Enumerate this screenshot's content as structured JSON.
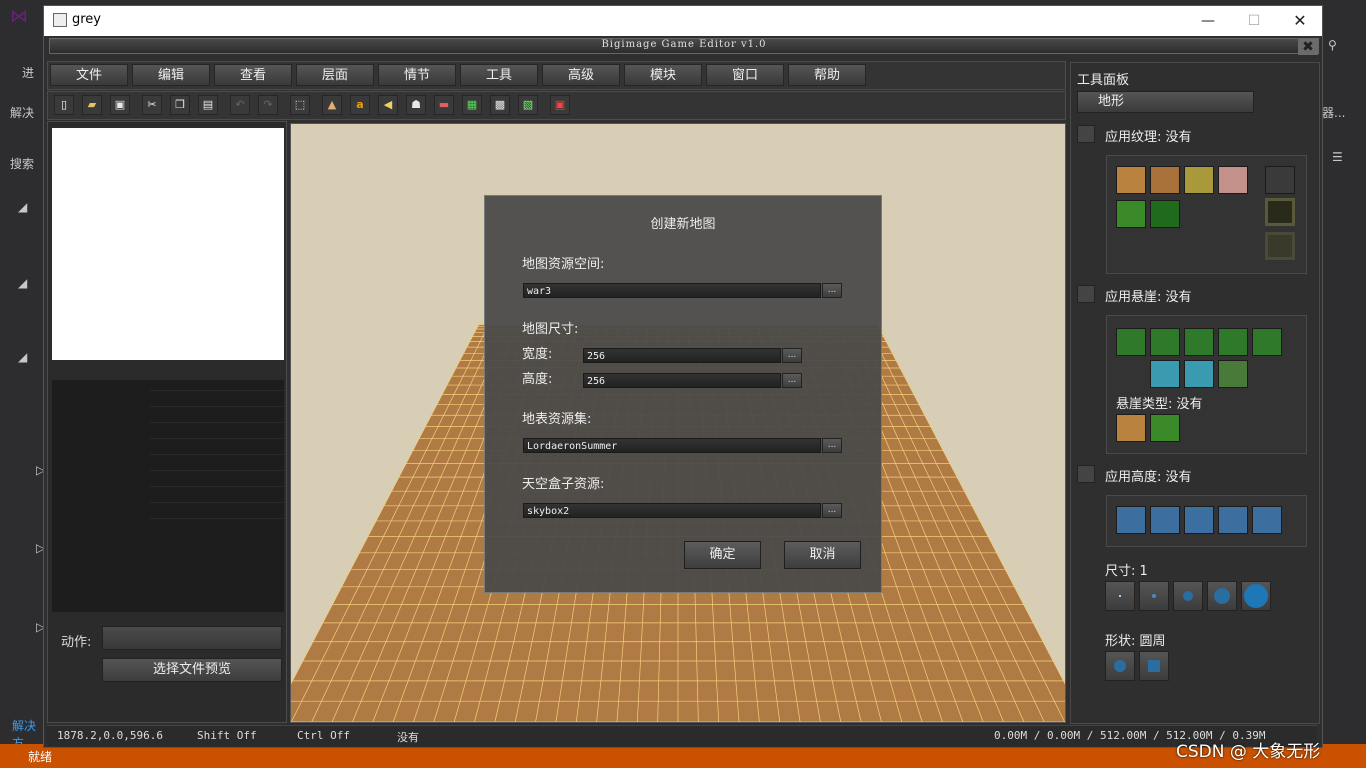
{
  "window": {
    "title": "grey",
    "editor_title": "Bigimage Game Editor v1.0"
  },
  "menu": [
    "文件",
    "编辑",
    "查看",
    "层面",
    "情节",
    "工具",
    "高级",
    "模块",
    "窗口",
    "帮助"
  ],
  "left_panel": {
    "action_label": "动作:",
    "preview_button": "选择文件预览"
  },
  "dialog": {
    "title": "创建新地图",
    "resource_space_label": "地图资源空间:",
    "resource_space_value": "war3",
    "size_label": "地图尺寸:",
    "width_label": "宽度:",
    "width_value": "256",
    "height_label": "高度:",
    "height_value": "256",
    "surface_set_label": "地表资源集:",
    "surface_set_value": "LordaeronSummer",
    "skybox_label": "天空盒子资源:",
    "skybox_value": "skybox2",
    "browse": "...",
    "ok": "确定",
    "cancel": "取消"
  },
  "tool_panel": {
    "title": "工具面板",
    "terrain_button": "地形",
    "apply_texture": "应用纹理: 没有",
    "apply_cliff": "应用悬崖: 没有",
    "cliff_type": "悬崖类型: 没有",
    "apply_height": "应用高度: 没有",
    "size": "尺寸: 1",
    "shape": "形状: 圆周"
  },
  "status": {
    "coords": "1878.2,0.0,596.6",
    "shift": "Shift Off",
    "ctrl": "Ctrl Off",
    "mode": "没有",
    "memory": "0.00M / 0.00M / 512.00M / 512.00M / 0.39M"
  },
  "background_ide": {
    "status_left": "就绪",
    "solution_label": "解决",
    "search_label": "搜索",
    "progress_label": "进",
    "solution_bottom": "解决方",
    "right_label": "器..."
  },
  "watermark": "CSDN @ 大象无形"
}
